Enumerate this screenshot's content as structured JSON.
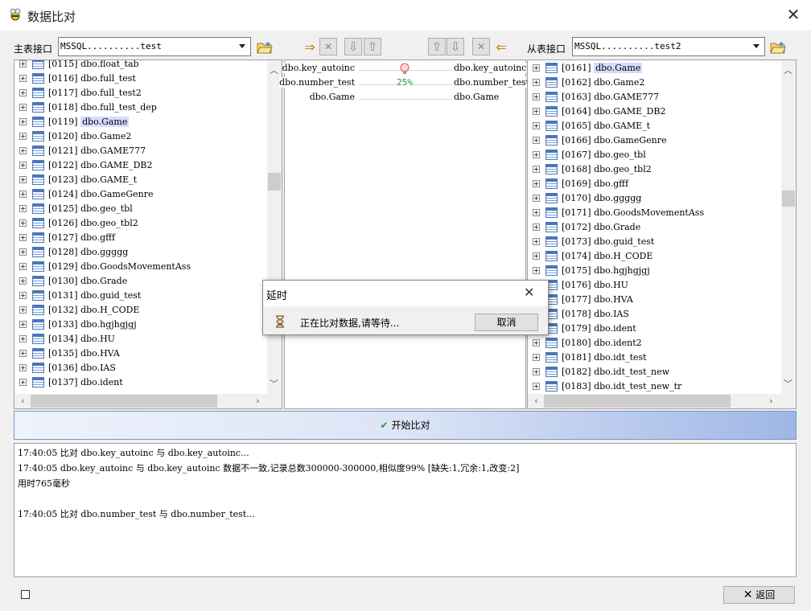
{
  "window": {
    "title": "数据比对",
    "close_glyph": "✕"
  },
  "master": {
    "label": "主表接口",
    "combo_value": "MSSQL..........test",
    "rows": [
      {
        "text": "[0115] dbo.float_tab",
        "selected": false
      },
      {
        "text": "[0116] dbo.full_test",
        "selected": false
      },
      {
        "text": "[0117] dbo.full_test2",
        "selected": false
      },
      {
        "text": "[0118] dbo.full_test_dep",
        "selected": false
      },
      {
        "text": "[0119] ",
        "name": "dbo.Game",
        "selected": true
      },
      {
        "text": "[0120] dbo.Game2",
        "selected": false
      },
      {
        "text": "[0121] dbo.GAME777",
        "selected": false
      },
      {
        "text": "[0122] dbo.GAME_DB2",
        "selected": false
      },
      {
        "text": "[0123] dbo.GAME_t",
        "selected": false
      },
      {
        "text": "[0124] dbo.GameGenre",
        "selected": false
      },
      {
        "text": "[0125] dbo.geo_tbl",
        "selected": false
      },
      {
        "text": "[0126] dbo.geo_tbl2",
        "selected": false
      },
      {
        "text": "[0127] dbo.gfff",
        "selected": false
      },
      {
        "text": "[0128] dbo.ggggg",
        "selected": false
      },
      {
        "text": "[0129] dbo.GoodsMovementAss",
        "selected": false
      },
      {
        "text": "[0130] dbo.Grade",
        "selected": false
      },
      {
        "text": "[0131] dbo.guid_test",
        "selected": false
      },
      {
        "text": "[0132] dbo.H_CODE",
        "selected": false
      },
      {
        "text": "[0133] dbo.hgjhgjgj",
        "selected": false
      },
      {
        "text": "[0134] dbo.HU",
        "selected": false
      },
      {
        "text": "[0135] dbo.HVA",
        "selected": false
      },
      {
        "text": "[0136] dbo.IAS",
        "selected": false
      },
      {
        "text": "[0137] dbo.ident",
        "selected": false
      }
    ]
  },
  "slave": {
    "label": "从表接口",
    "combo_value": "MSSQL..........test2",
    "rows": [
      {
        "text": "[0161] ",
        "name": "dbo.Game",
        "selected": true
      },
      {
        "text": "[0162] dbo.Game2",
        "selected": false
      },
      {
        "text": "[0163] dbo.GAME777",
        "selected": false
      },
      {
        "text": "[0164] dbo.GAME_DB2",
        "selected": false
      },
      {
        "text": "[0165] dbo.GAME_t",
        "selected": false
      },
      {
        "text": "[0166] dbo.GameGenre",
        "selected": false
      },
      {
        "text": "[0167] dbo.geo_tbl",
        "selected": false
      },
      {
        "text": "[0168] dbo.geo_tbl2",
        "selected": false
      },
      {
        "text": "[0169] dbo.gfff",
        "selected": false
      },
      {
        "text": "[0170] dbo.ggggg",
        "selected": false
      },
      {
        "text": "[0171] dbo.GoodsMovementAss",
        "selected": false
      },
      {
        "text": "[0172] dbo.Grade",
        "selected": false
      },
      {
        "text": "[0173] dbo.guid_test",
        "selected": false
      },
      {
        "text": "[0174] dbo.H_CODE",
        "selected": false
      },
      {
        "text": "[0175] dbo.hgjhgjgj",
        "selected": false
      },
      {
        "text": "[0176] dbo.HU",
        "selected": false
      },
      {
        "text": "[0177] dbo.HVA",
        "selected": false
      },
      {
        "text": "[0178] dbo.IAS",
        "selected": false
      },
      {
        "text": "[0179] dbo.ident",
        "selected": false
      },
      {
        "text": "[0180] dbo.ident2",
        "selected": false
      },
      {
        "text": "[0181] dbo.idt_test",
        "selected": false
      },
      {
        "text": "[0182] dbo.idt_test_new",
        "selected": false
      },
      {
        "text": "[0183] dbo.idt_test_new_tr",
        "selected": false
      }
    ]
  },
  "pairs": [
    {
      "left": "dbo.key_autoinc",
      "status": "bulb",
      "right": "dbo.key_autoinc"
    },
    {
      "left": "dbo.number_test",
      "status": "25%",
      "right": "dbo.number_test"
    },
    {
      "left": "dbo.Game",
      "status": "",
      "right": "dbo.Game"
    }
  ],
  "toolbar": {
    "add_glyph": "⇒",
    "delete_glyph": "✕",
    "down_glyph": "⇩",
    "up_glyph": "⇧",
    "remove_glyph": "⇐"
  },
  "start_button": {
    "label": "开始比对",
    "icon_glyph": "✔"
  },
  "log_lines": [
    "17:40:05 比对 dbo.key_autoinc 与 dbo.key_autoinc...",
    "17:40:05 dbo.key_autoinc 与 dbo.key_autoinc 数据不一致,记录总数300000-300000,相似度99% [缺失:1,冗余:1,改变:2]",
    "用时765毫秒",
    "",
    "17:40:05 比对 dbo.number_test 与 dbo.number_test..."
  ],
  "dialog": {
    "title": "延时",
    "message": "正在比对数据,请等待...",
    "cancel_label": "取消",
    "close_glyph": "✕"
  },
  "return_button": {
    "label": "返回",
    "icon_glyph": "✕"
  },
  "colors": {
    "accent": "#9fb6e6",
    "selection": "#d6dcff",
    "percent": "#1a9a2a"
  }
}
